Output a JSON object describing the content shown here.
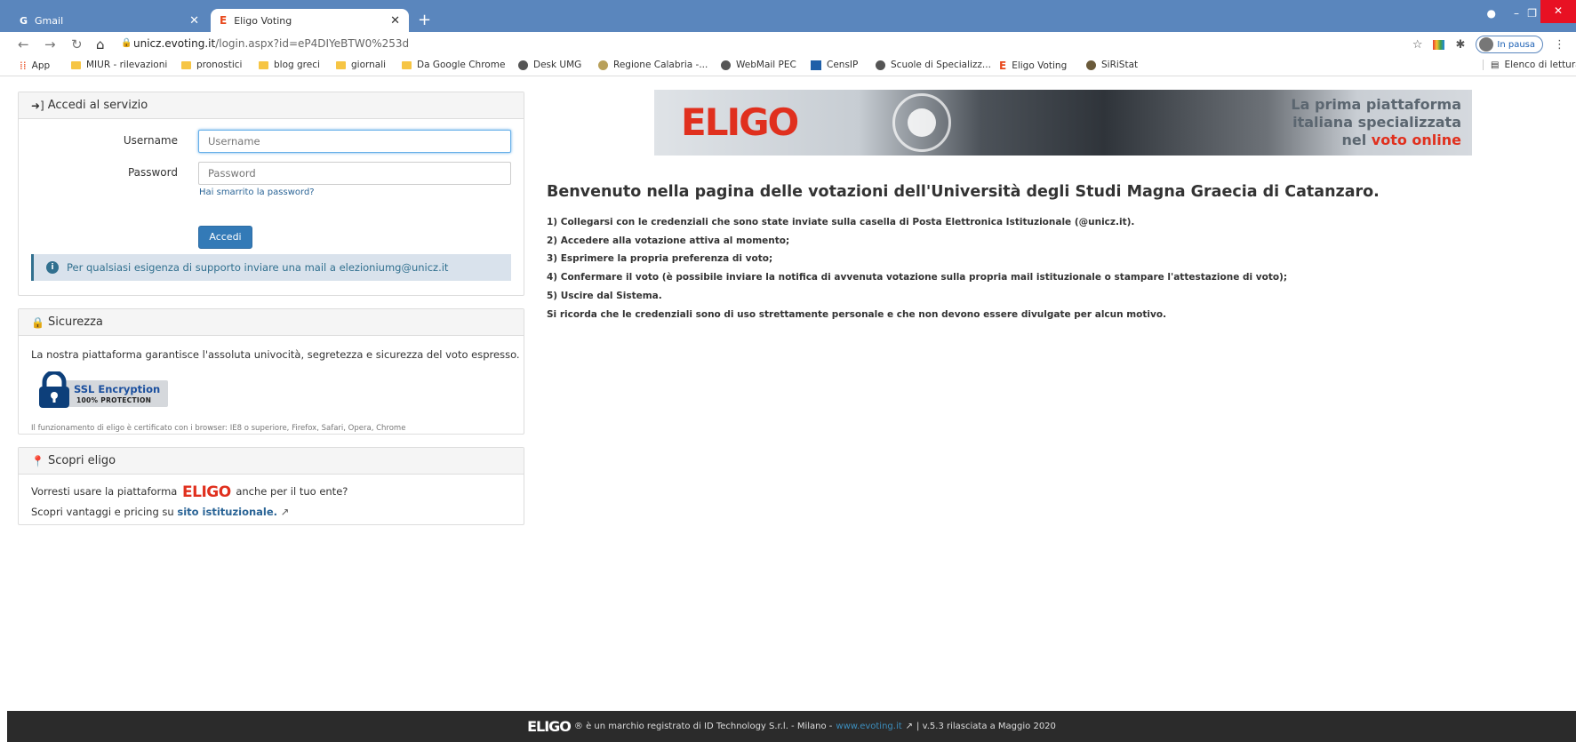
{
  "browser": {
    "tabs": [
      {
        "title": "Gmail",
        "active": false
      },
      {
        "title": "Eligo Voting",
        "active": true
      }
    ],
    "new_tab": "+",
    "url_host": "unicz.evoting.it",
    "url_path": "/login.aspx?id=eP4DIYeBTW0%253d",
    "profile_status": "In pausa",
    "bookmarks": [
      {
        "label": "App",
        "icon": "apps-grid-icon"
      },
      {
        "label": "MIUR - rilevazioni",
        "icon": "folder-icon"
      },
      {
        "label": "pronostici",
        "icon": "folder-icon"
      },
      {
        "label": "blog greci",
        "icon": "folder-icon"
      },
      {
        "label": "giornali",
        "icon": "folder-icon"
      },
      {
        "label": "Da Google Chrome",
        "icon": "folder-icon"
      },
      {
        "label": "Desk UMG",
        "icon": "globe-icon"
      },
      {
        "label": "Regione Calabria -...",
        "icon": "globe-icon"
      },
      {
        "label": "WebMail PEC",
        "icon": "globe-icon"
      },
      {
        "label": "CensIP",
        "icon": "grid-icon"
      },
      {
        "label": "Scuole di Specializz...",
        "icon": "globe-icon"
      },
      {
        "label": "Eligo Voting",
        "icon": "eligo-icon"
      },
      {
        "label": "SiRiStat",
        "icon": "globe-icon"
      }
    ],
    "reading_list": "Elenco di lettura"
  },
  "login": {
    "title": "Accedi al servizio",
    "username_label": "Username",
    "username_placeholder": "Username",
    "password_label": "Password",
    "password_placeholder": "Password",
    "forgot": "Hai smarrito la password?",
    "submit": "Accedi",
    "support": "Per qualsiasi esigenza di supporto inviare una mail a elezioniumg@unicz.it"
  },
  "security": {
    "title": "Sicurezza",
    "text": "La nostra piattaforma garantisce l'assoluta univocità, segretezza e sicurezza del voto espresso.",
    "ssl_title": "SSL Encryption",
    "ssl_sub": "100% PROTECTION",
    "note": "Il funzionamento di eligo è certificato con i browser: IE8 o superiore, Firefox, Safari, Opera, Chrome"
  },
  "discover": {
    "title": "Scopri eligo",
    "line1_pre": "Vorresti usare la piattaforma",
    "logo": "ELIGO",
    "line1_post": "anche per il tuo ente?",
    "line2_pre": "Scopri vantaggi e pricing su",
    "line2_link": "sito istituzionale."
  },
  "banner": {
    "logo": "ELIGO",
    "line1": "La prima piattaforma",
    "line2": "italiana specializzata",
    "line3_pre": "nel",
    "line3_red": "voto online"
  },
  "main": {
    "welcome": "Benvenuto nella pagina delle votazioni dell'Università degli Studi Magna Graecia di Catanzaro.",
    "steps": [
      "1) Collegarsi con le credenziali che sono state inviate sulla casella di Posta Elettronica Istituzionale (@unicz.it).",
      "2) Accedere alla votazione attiva al momento;",
      "3) Esprimere la propria preferenza di voto;",
      "4) Confermare il voto (è possibile inviare la notifica di avvenuta votazione sulla propria mail istituzionale o stampare l'attestazione di voto);",
      "5) Uscire dal Sistema.",
      "Si ricorda che le credenziali sono di uso strettamente personale e che non devono essere divulgate per alcun motivo."
    ]
  },
  "footer": {
    "logo": "ELIGO",
    "text1": "® è un marchio registrato di ID Technology S.r.l. - Milano -",
    "link": "www.evoting.it",
    "text2": "| v.5.3 rilasciata a Maggio 2020"
  },
  "colors": {
    "brand_red": "#e0301e",
    "primary_button": "#337ab7",
    "chrome_frame": "#5a86bd"
  }
}
